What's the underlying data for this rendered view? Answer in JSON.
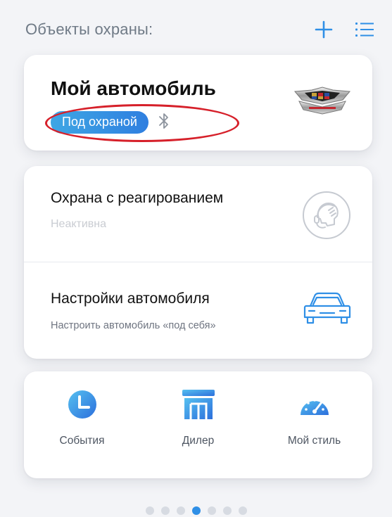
{
  "header": {
    "title": "Объекты охраны:",
    "add_icon": "plus-icon",
    "list_icon": "list-icon"
  },
  "vehicle": {
    "name": "Мой автомобиль",
    "status": "Под охраной",
    "bluetooth_icon": "bluetooth-icon",
    "logo_icon": "cadillac-logo-icon"
  },
  "services": [
    {
      "title": "Охрана с реагированием",
      "subtitle": "Неактивна",
      "icon": "operator-headset-icon"
    },
    {
      "title": "Настройки автомобиля",
      "subtitle": "Настроить автомобиль «под себя»",
      "icon": "car-settings-icon"
    }
  ],
  "quick_actions": [
    {
      "label": "События",
      "icon": "clock-icon"
    },
    {
      "label": "Дилер",
      "icon": "dealer-building-icon"
    },
    {
      "label": "Мой стиль",
      "icon": "speedometer-icon"
    }
  ],
  "pagination": {
    "total": 7,
    "active_index": 3
  },
  "colors": {
    "accent": "#2f8fe6",
    "highlight": "#d6202a",
    "background": "#f3f4f7"
  }
}
